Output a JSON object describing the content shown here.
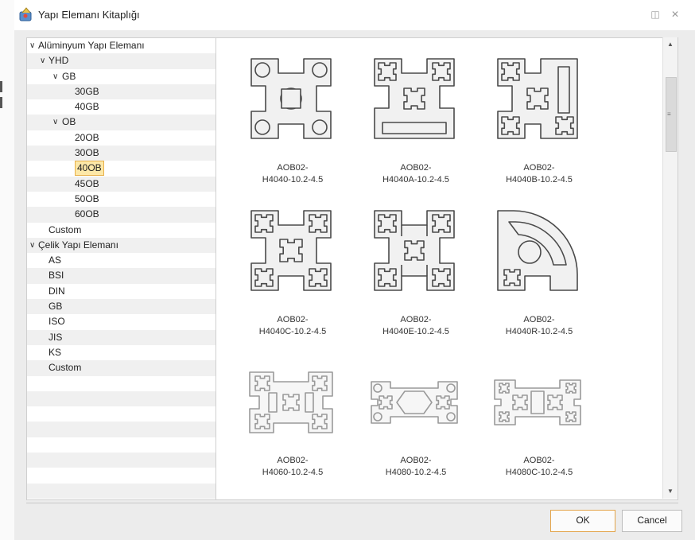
{
  "window": {
    "title": "Yapı Elemanı Kitaplığı"
  },
  "tree": {
    "rows": [
      {
        "label": "Alüminyum Yapı Elemanı",
        "level": 0,
        "expanded": true
      },
      {
        "label": "YHD",
        "level": 1,
        "expanded": true
      },
      {
        "label": "GB",
        "level": 2,
        "expanded": true
      },
      {
        "label": "30GB",
        "level": 3
      },
      {
        "label": "40GB",
        "level": 3
      },
      {
        "label": "OB",
        "level": 2,
        "expanded": true
      },
      {
        "label": "20OB",
        "level": 3
      },
      {
        "label": "30OB",
        "level": 3
      },
      {
        "label": "40OB",
        "level": 3,
        "selected": true
      },
      {
        "label": "45OB",
        "level": 3
      },
      {
        "label": "50OB",
        "level": 3
      },
      {
        "label": "60OB",
        "level": 3
      },
      {
        "label": "Custom",
        "level": 1
      },
      {
        "label": "Çelik Yapı Elemanı",
        "level": 0,
        "expanded": true
      },
      {
        "label": "AS",
        "level": 1
      },
      {
        "label": "BSI",
        "level": 1
      },
      {
        "label": "DIN",
        "level": 1
      },
      {
        "label": "GB",
        "level": 1
      },
      {
        "label": "ISO",
        "level": 1
      },
      {
        "label": "JIS",
        "level": 1
      },
      {
        "label": "KS",
        "level": 1
      },
      {
        "label": "Custom",
        "level": 1
      },
      {
        "label": "",
        "level": 1
      },
      {
        "label": "",
        "level": 1
      },
      {
        "label": "",
        "level": 1
      },
      {
        "label": "",
        "level": 1
      },
      {
        "label": "",
        "level": 1
      },
      {
        "label": "",
        "level": 1
      },
      {
        "label": "",
        "level": 1
      },
      {
        "label": "",
        "level": 1
      }
    ]
  },
  "gallery": {
    "items": [
      {
        "line1": "AOB02-",
        "line2": "H4040-10.2-4.5",
        "shape": "x-profile-round-corners"
      },
      {
        "line1": "AOB02-",
        "line2": "H4040A-10.2-4.5",
        "shape": "a-profile-closed-bottom"
      },
      {
        "line1": "AOB02-",
        "line2": "H4040B-10.2-4.5",
        "shape": "b-profile-closed-side"
      },
      {
        "line1": "AOB02-",
        "line2": "H4040C-10.2-4.5",
        "shape": "c-profile-four-slots"
      },
      {
        "line1": "AOB02-",
        "line2": "H4040E-10.2-4.5",
        "shape": "e-profile-four-slots"
      },
      {
        "line1": "AOB02-",
        "line2": "H4040R-10.2-4.5",
        "shape": "r-profile-quarter-round"
      },
      {
        "line1": "AOB02-",
        "line2": "H4060-10.2-4.5",
        "shape": "h4060-profile",
        "faded": true
      },
      {
        "line1": "AOB02-",
        "line2": "H4080-10.2-4.5",
        "shape": "h4080-profile",
        "faded": true
      },
      {
        "line1": "AOB02-",
        "line2": "H4080C-10.2-4.5",
        "shape": "h4080c-profile",
        "faded": true
      }
    ]
  },
  "buttons": {
    "ok": "OK",
    "cancel": "Cancel"
  },
  "colors": {
    "selection_fill": "#fde8a8",
    "selection_border": "#e8b04a",
    "ok_border": "#e3a44a"
  }
}
